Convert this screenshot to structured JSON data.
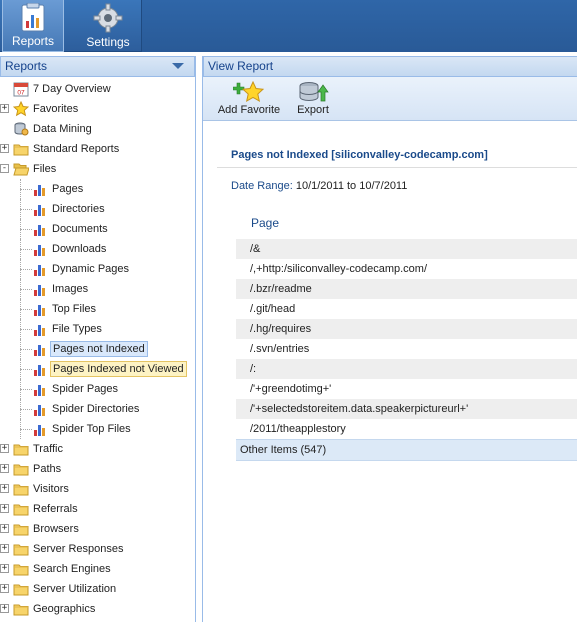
{
  "toolbar": {
    "reports_label": "Reports",
    "settings_label": "Settings"
  },
  "left_panel": {
    "title": "Reports",
    "tree": [
      {
        "label": "7 Day Overview",
        "icon": "calendar-icon",
        "level": 0,
        "expander": false
      },
      {
        "label": "Favorites",
        "icon": "star-icon",
        "level": 0,
        "expander": "+"
      },
      {
        "label": "Data Mining",
        "icon": "database-icon",
        "level": 0,
        "expander": false
      },
      {
        "label": "Standard Reports",
        "icon": "folder-icon",
        "level": 0,
        "expander": "+"
      },
      {
        "label": "Files",
        "icon": "folder-open-icon",
        "level": 0,
        "expander": "-"
      },
      {
        "label": "Pages",
        "icon": "bar-chart-icon",
        "level": 1
      },
      {
        "label": "Directories",
        "icon": "bar-chart-icon",
        "level": 1
      },
      {
        "label": "Documents",
        "icon": "bar-chart-icon",
        "level": 1
      },
      {
        "label": "Downloads",
        "icon": "bar-chart-icon",
        "level": 1
      },
      {
        "label": "Dynamic Pages",
        "icon": "bar-chart-icon",
        "level": 1
      },
      {
        "label": "Images",
        "icon": "bar-chart-icon",
        "level": 1
      },
      {
        "label": "Top Files",
        "icon": "bar-chart-icon",
        "level": 1
      },
      {
        "label": "File Types",
        "icon": "bar-chart-icon",
        "level": 1
      },
      {
        "label": "Pages not Indexed",
        "icon": "bar-chart-icon",
        "level": 1,
        "state": "selected"
      },
      {
        "label": "Pages Indexed not Viewed",
        "icon": "bar-chart-icon",
        "level": 1,
        "state": "hover"
      },
      {
        "label": "Spider Pages",
        "icon": "bar-chart-icon",
        "level": 1
      },
      {
        "label": "Spider Directories",
        "icon": "bar-chart-icon",
        "level": 1
      },
      {
        "label": "Spider Top Files",
        "icon": "bar-chart-icon",
        "level": 1
      },
      {
        "label": "Traffic",
        "icon": "folder-icon",
        "level": 0,
        "expander": "+"
      },
      {
        "label": "Paths",
        "icon": "folder-icon",
        "level": 0,
        "expander": "+"
      },
      {
        "label": "Visitors",
        "icon": "folder-icon",
        "level": 0,
        "expander": "+"
      },
      {
        "label": "Referrals",
        "icon": "folder-icon",
        "level": 0,
        "expander": "+"
      },
      {
        "label": "Browsers",
        "icon": "folder-icon",
        "level": 0,
        "expander": "+"
      },
      {
        "label": "Server Responses",
        "icon": "folder-icon",
        "level": 0,
        "expander": "+"
      },
      {
        "label": "Search Engines",
        "icon": "folder-icon",
        "level": 0,
        "expander": "+"
      },
      {
        "label": "Server Utilization",
        "icon": "folder-icon",
        "level": 0,
        "expander": "+"
      },
      {
        "label": "Geographics",
        "icon": "folder-icon",
        "level": 0,
        "expander": "+"
      }
    ]
  },
  "right_panel": {
    "title": "View Report",
    "add_favorite_label": "Add Favorite",
    "export_label": "Export",
    "report_title": "Pages not Indexed [siliconvalley-codecamp.com]",
    "date_range_label": "Date Range:",
    "date_range_value": "10/1/2011 to 10/7/2011",
    "column_header": "Page",
    "rows": [
      "/&",
      "/,+http:/siliconvalley-codecamp.com/",
      "/.bzr/readme",
      "/.git/head",
      "/.hg/requires",
      "/.svn/entries",
      "/:",
      "/'+greendotimg+'",
      "/'+selectedstoreitem.data.speakerpictureurl+'",
      "/2011/theapplestory"
    ],
    "other_items": "Other Items (547)"
  },
  "colors": {
    "toolbar_blue": "#2d5e9c",
    "panel_header_text": "#15428b",
    "selected_bg": "#d9e8fb",
    "hover_bg": "#fdf3c4"
  }
}
